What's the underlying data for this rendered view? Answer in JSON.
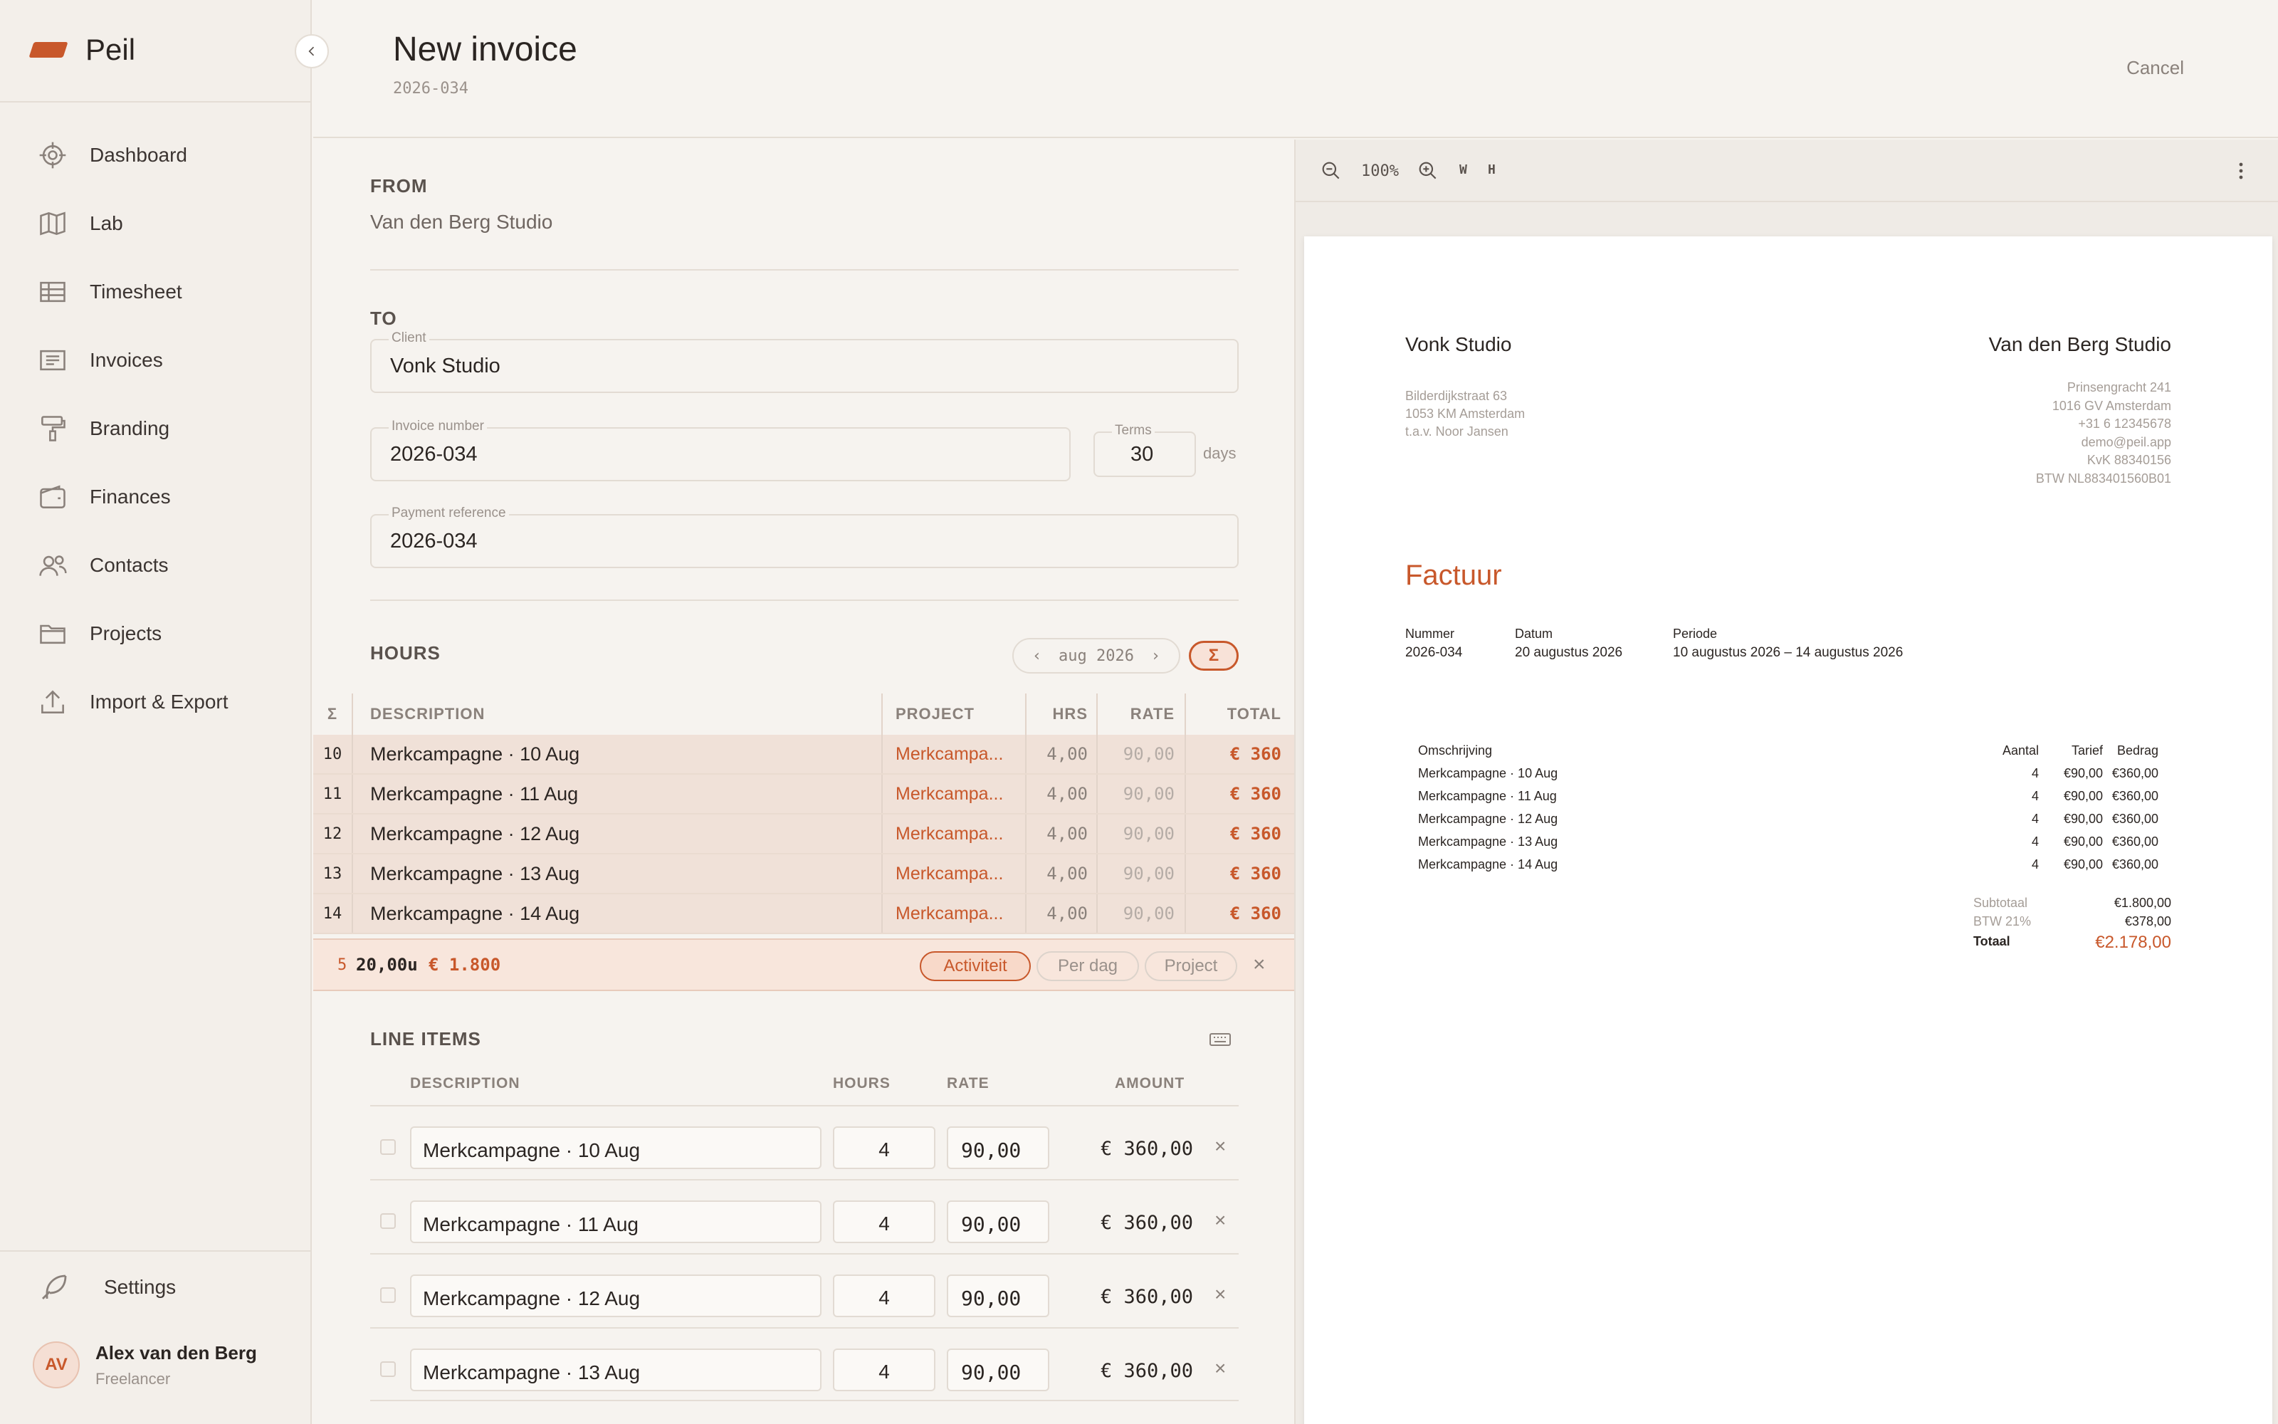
{
  "app": {
    "name": "Peil"
  },
  "sidebar": {
    "items": [
      {
        "label": "Dashboard"
      },
      {
        "label": "Lab"
      },
      {
        "label": "Timesheet"
      },
      {
        "label": "Invoices"
      },
      {
        "label": "Branding"
      },
      {
        "label": "Finances"
      },
      {
        "label": "Contacts"
      },
      {
        "label": "Projects"
      },
      {
        "label": "Import & Export"
      }
    ],
    "settings": "Settings",
    "user": {
      "initials": "AV",
      "name": "Alex van den Berg",
      "role": "Freelancer"
    }
  },
  "header": {
    "title": "New invoice",
    "subtitle": "2026-034",
    "cancel": "Cancel"
  },
  "form": {
    "from_label": "FROM",
    "from_value": "Van den Berg Studio",
    "to_label": "TO",
    "client_label": "Client",
    "client_value": "Vonk Studio",
    "invoice_number_label": "Invoice number",
    "invoice_number_value": "2026-034",
    "terms_label": "Terms",
    "terms_value": "30",
    "terms_unit": "days",
    "payment_ref_label": "Payment reference",
    "payment_ref_value": "2026-034"
  },
  "hours": {
    "title": "HOURS",
    "month": "aug 2026",
    "sigma": "Σ",
    "columns": {
      "sigma": "Σ",
      "description": "DESCRIPTION",
      "project": "PROJECT",
      "hrs": "HRS",
      "rate": "RATE",
      "total": "TOTAL"
    },
    "rows": [
      {
        "day": "10",
        "description": "Merkcampagne · 10 Aug",
        "project": "Merkcampa...",
        "hrs": "4,00",
        "rate": "90,00",
        "total": "€ 360"
      },
      {
        "day": "11",
        "description": "Merkcampagne · 11 Aug",
        "project": "Merkcampa...",
        "hrs": "4,00",
        "rate": "90,00",
        "total": "€ 360"
      },
      {
        "day": "12",
        "description": "Merkcampagne · 12 Aug",
        "project": "Merkcampa...",
        "hrs": "4,00",
        "rate": "90,00",
        "total": "€ 360"
      },
      {
        "day": "13",
        "description": "Merkcampagne · 13 Aug",
        "project": "Merkcampa...",
        "hrs": "4,00",
        "rate": "90,00",
        "total": "€ 360"
      },
      {
        "day": "14",
        "description": "Merkcampagne · 14 Aug",
        "project": "Merkcampa...",
        "hrs": "4,00",
        "rate": "90,00",
        "total": "€ 360"
      }
    ],
    "summary": {
      "count": "5",
      "hours": "20,00u",
      "total": "€ 1.800",
      "groupings": [
        "Activiteit",
        "Per dag",
        "Project"
      ],
      "active": "Activiteit"
    }
  },
  "line_items": {
    "title": "LINE ITEMS",
    "columns": {
      "description": "DESCRIPTION",
      "hours": "HOURS",
      "rate": "RATE",
      "amount": "AMOUNT"
    },
    "rows": [
      {
        "description": "Merkcampagne · 10 Aug",
        "hours": "4",
        "rate": "90,00",
        "amount": "€ 360,00"
      },
      {
        "description": "Merkcampagne · 11 Aug",
        "hours": "4",
        "rate": "90,00",
        "amount": "€ 360,00"
      },
      {
        "description": "Merkcampagne · 12 Aug",
        "hours": "4",
        "rate": "90,00",
        "amount": "€ 360,00"
      },
      {
        "description": "Merkcampagne · 13 Aug",
        "hours": "4",
        "rate": "90,00",
        "amount": "€ 360,00"
      }
    ]
  },
  "preview": {
    "toolbar": {
      "zoom": "100%",
      "w": "W",
      "h": "H"
    },
    "client": {
      "name": "Vonk Studio",
      "lines": [
        "Bilderdijkstraat 63",
        "1053 KM Amsterdam",
        "t.a.v. Noor Jansen"
      ]
    },
    "sender": {
      "name": "Van den Berg Studio",
      "lines": [
        "Prinsengracht 241",
        "1016 GV  Amsterdam",
        "+31 6 12345678",
        "demo@peil.app",
        "KvK 88340156",
        "BTW NL883401560B01"
      ]
    },
    "doc_title": "Factuur",
    "meta": [
      {
        "label": "Nummer",
        "value": "2026-034"
      },
      {
        "label": "Datum",
        "value": "20 augustus 2026"
      },
      {
        "label": "Periode",
        "value": "10 augustus 2026 – 14 augustus 2026"
      }
    ],
    "table_head": {
      "description": "Omschrijving",
      "qty": "Aantal",
      "rate": "Tarief",
      "amount": "Bedrag"
    },
    "table_rows": [
      {
        "description": "Merkcampagne · 10 Aug",
        "qty": "4",
        "rate": "€90,00",
        "amount": "€360,00"
      },
      {
        "description": "Merkcampagne · 11 Aug",
        "qty": "4",
        "rate": "€90,00",
        "amount": "€360,00"
      },
      {
        "description": "Merkcampagne · 12 Aug",
        "qty": "4",
        "rate": "€90,00",
        "amount": "€360,00"
      },
      {
        "description": "Merkcampagne · 13 Aug",
        "qty": "4",
        "rate": "€90,00",
        "amount": "€360,00"
      },
      {
        "description": "Merkcampagne · 14 Aug",
        "qty": "4",
        "rate": "€90,00",
        "amount": "€360,00"
      }
    ],
    "totals": {
      "subtotal_label": "Subtotaal",
      "subtotal": "€1.800,00",
      "vat_label": "BTW 21%",
      "vat": "€378,00",
      "total_label": "Totaal",
      "total": "€2.178,00"
    }
  },
  "colors": {
    "accent": "#c8582b",
    "background": "#f6f3ef",
    "highlight_row": "#f0e1d8"
  }
}
